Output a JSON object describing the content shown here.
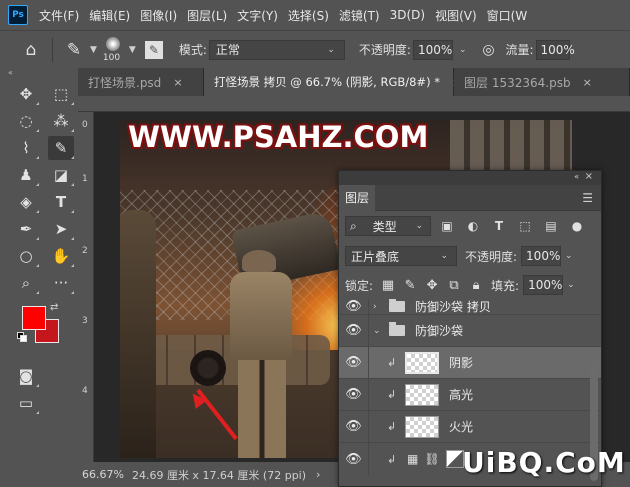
{
  "menubar": {
    "logo": "Ps",
    "items": [
      "文件(F)",
      "编辑(E)",
      "图像(I)",
      "图层(L)",
      "文字(Y)",
      "选择(S)",
      "滤镜(T)",
      "3D(D)",
      "视图(V)",
      "窗口(W"
    ]
  },
  "options": {
    "brush_size": "100",
    "mode_label": "模式:",
    "mode_value": "正常",
    "opacity_label": "不透明度:",
    "opacity_value": "100%",
    "flow_label": "流量:",
    "flow_value": "100%"
  },
  "tabs": [
    {
      "label": "打怪场景.psd",
      "close": "×",
      "active": false
    },
    {
      "label": "打怪场景 拷贝 @ 66.7% (阴影, RGB/8#) *",
      "close": "×",
      "active": true
    },
    {
      "label": "图层 1532364.psb",
      "close": "×",
      "active": false
    }
  ],
  "rulers": {
    "left_numbers": [
      "0",
      "1",
      "2",
      "3",
      "4"
    ]
  },
  "artwork": {
    "watermark": "WWW.PSAHZ.COM"
  },
  "colors": {
    "foreground": "#ff0000",
    "background": "#c4161c"
  },
  "status": {
    "zoom": "66.67%",
    "info": "24.69 厘米 x 17.64 厘米 (72 ppi)",
    "arrow": "›"
  },
  "layers_panel": {
    "tab": "图层",
    "filter_label": "类型",
    "blend_mode": "正片叠底",
    "opacity_label": "不透明度:",
    "opacity_value": "100%",
    "lock_label": "锁定:",
    "fill_label": "填充:",
    "fill_value": "100%",
    "layers": [
      {
        "name": "防御沙袋 拷贝",
        "type": "group",
        "selected": false
      },
      {
        "name": "防御沙袋",
        "type": "group-open",
        "selected": false
      },
      {
        "name": "阴影",
        "type": "layer",
        "selected": true
      },
      {
        "name": "高光",
        "type": "layer",
        "selected": false
      },
      {
        "name": "火光",
        "type": "layer",
        "selected": false
      }
    ]
  },
  "site_watermark": "UiBQ.CoM"
}
